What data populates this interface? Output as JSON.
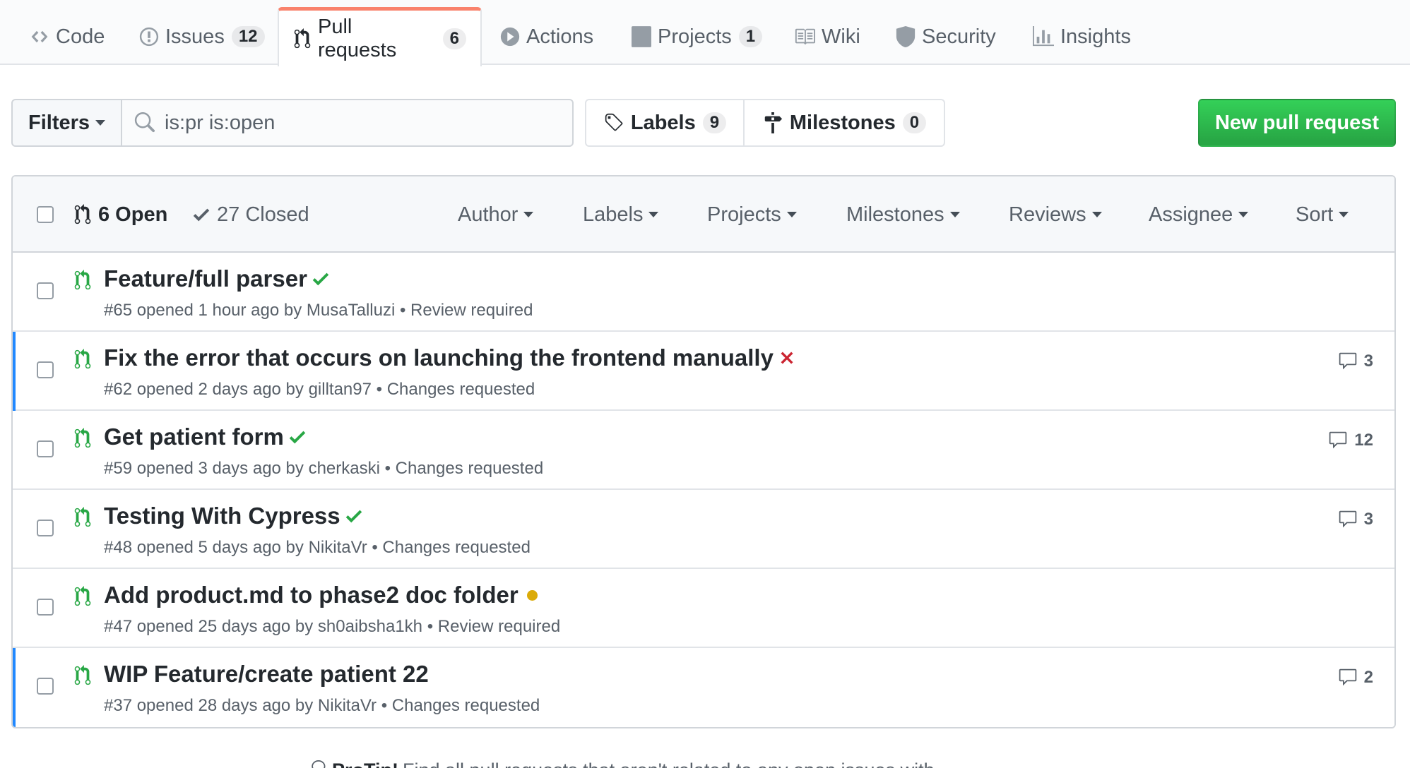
{
  "tabs": [
    {
      "label": "Code",
      "icon": "code-icon"
    },
    {
      "label": "Issues",
      "count": "12",
      "icon": "issue-opened-icon"
    },
    {
      "label": "Pull requests",
      "count": "6",
      "icon": "git-pull-request-icon",
      "selected": true
    },
    {
      "label": "Actions",
      "icon": "play-icon"
    },
    {
      "label": "Projects",
      "count": "1",
      "icon": "project-icon"
    },
    {
      "label": "Wiki",
      "icon": "book-icon"
    },
    {
      "label": "Security",
      "icon": "shield-icon"
    },
    {
      "label": "Insights",
      "icon": "graph-icon"
    }
  ],
  "subnav": {
    "filters_label": "Filters",
    "search_value": "is:pr is:open",
    "labels_label": "Labels",
    "labels_count": "9",
    "milestones_label": "Milestones",
    "milestones_count": "0",
    "new_pr_label": "New pull request"
  },
  "list_header": {
    "open_label": "6 Open",
    "closed_label": "27 Closed",
    "filters": [
      "Author",
      "Labels",
      "Projects",
      "Milestones",
      "Reviews",
      "Assignee",
      "Sort"
    ]
  },
  "pull_requests": [
    {
      "title": "Feature/full parser",
      "status": "success",
      "meta": "#65 opened 1 hour ago by MusaTalluzi • Review required",
      "comments": ""
    },
    {
      "title": "Fix the error that occurs on launching the frontend manually",
      "status": "failure",
      "meta": "#62 opened 2 days ago by gilltan97 • Changes requested",
      "comments": "3"
    },
    {
      "title": "Get patient form",
      "status": "success",
      "meta": "#59 opened 3 days ago by cherkaski • Changes requested",
      "comments": "12"
    },
    {
      "title": "Testing With Cypress",
      "status": "success",
      "meta": "#48 opened 5 days ago by NikitaVr • Changes requested",
      "comments": "3"
    },
    {
      "title": "Add product.md to phase2 doc folder",
      "status": "pending",
      "meta": "#47 opened 25 days ago by sh0aibsha1kh • Review required",
      "comments": ""
    },
    {
      "title": "WIP Feature/create patient 22",
      "status": "none",
      "meta": "#37 opened 28 days ago by NikitaVr • Changes requested",
      "comments": "2"
    }
  ],
  "protip": {
    "label": "ProTip!",
    "text": "Find all pull requests that aren't related to any open issues with"
  },
  "colors": {
    "accent_tab": "#f9826c",
    "primary_green": "#28a745",
    "failure_red": "#cb2431",
    "pending_yellow": "#dbab09",
    "unread_blue": "#2188ff"
  }
}
